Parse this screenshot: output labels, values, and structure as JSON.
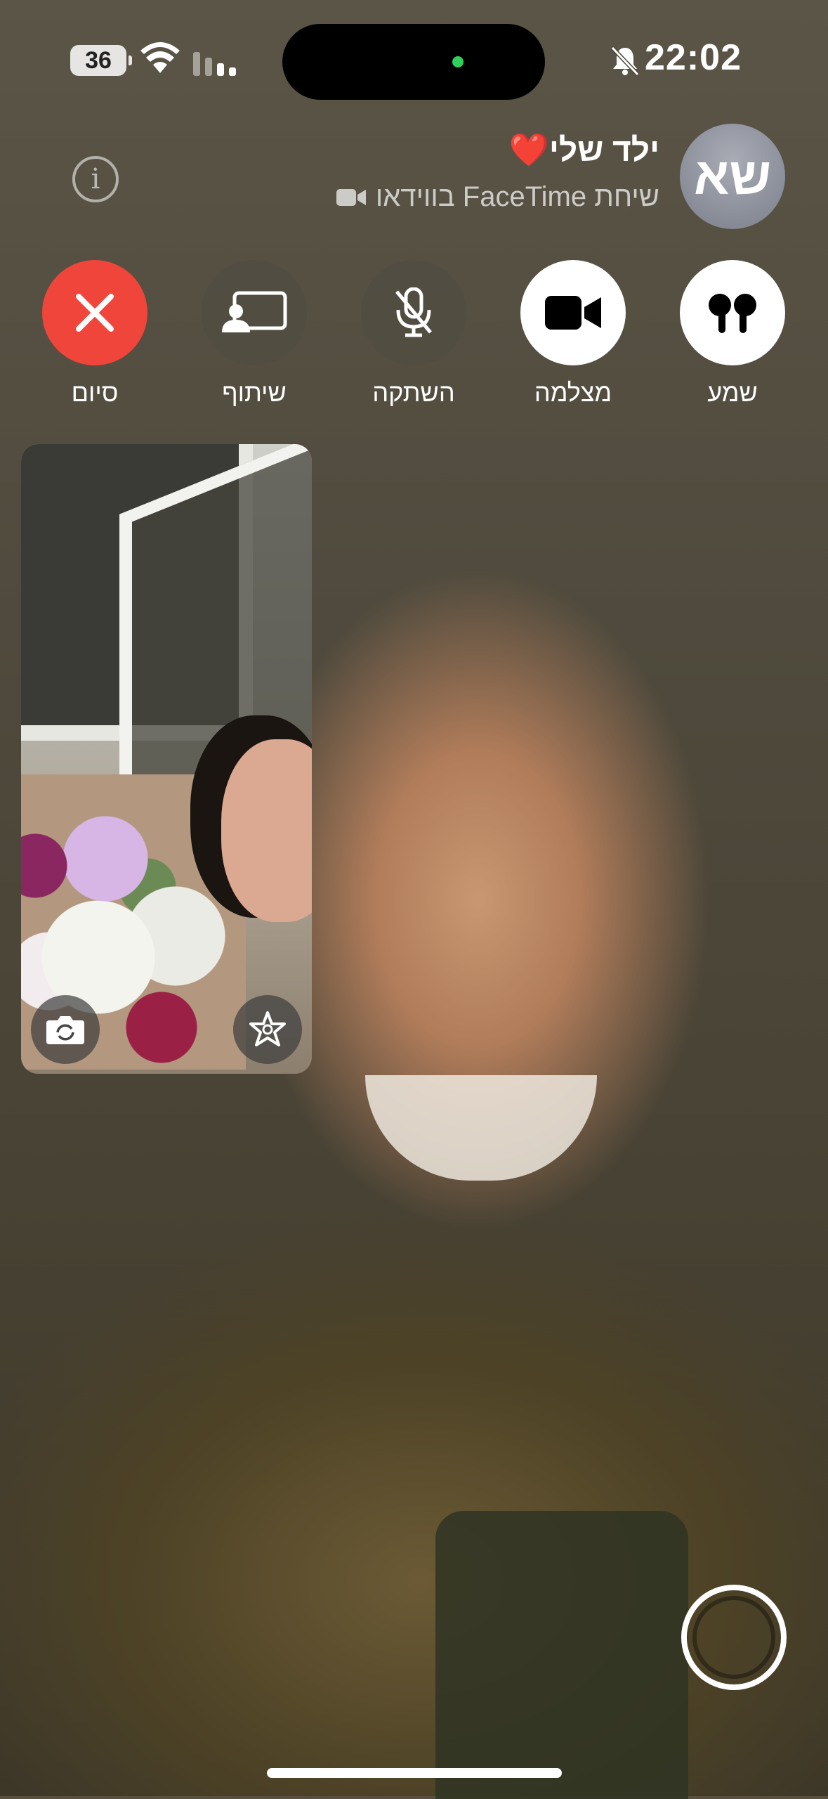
{
  "status_bar": {
    "battery": "36",
    "time": "22:02",
    "icons": [
      "wifi-icon",
      "cellular-signal-icon",
      "silent-bell-icon"
    ]
  },
  "call": {
    "contact_name": "ילד שלי",
    "contact_emoji": "❤️",
    "avatar_initials": "שא",
    "call_type": "שיחת FaceTime בווידאו"
  },
  "controls": {
    "share_audio": {
      "label": "שמע",
      "icon": "airpods-icon"
    },
    "camera": {
      "label": "מצלמה",
      "icon": "video-camera-icon"
    },
    "mute": {
      "label": "השתקה",
      "icon": "microphone-muted-icon"
    },
    "share": {
      "label": "שיתוף",
      "icon": "shareplay-icon"
    },
    "end": {
      "label": "סיום",
      "icon": "close-icon"
    }
  },
  "colors": {
    "end_button": "#f0453a",
    "active_button": "#ffffff",
    "inactive_button": "#504c42",
    "island_dot": "#2fd158",
    "heart": "#ff2d3a"
  }
}
